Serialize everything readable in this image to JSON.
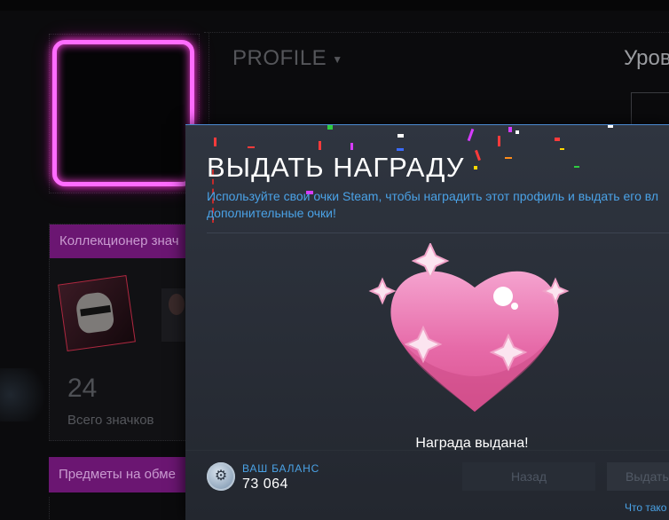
{
  "profile": {
    "dropdown_label": "PROFILE",
    "level_label": "Уров"
  },
  "showcase": {
    "badge_collector_header": "Коллекционер знач",
    "badge_count": "24",
    "badge_count_label": "Всего значков",
    "trade_header": "Предметы на обме"
  },
  "modal": {
    "title": "ВЫДАТЬ НАГРАДУ",
    "description": "Используйте свои очки Steam, чтобы наградить этот профиль и выдать его вл дополнительные очки!",
    "caption": "Награда выдана!",
    "balance_label": "ВАШ БАЛАНС",
    "balance_value": "73 064",
    "back_button": "Назад",
    "give_button": "Выдать",
    "what_link": "Что тако"
  },
  "colors": {
    "accent_blue": "#4aa2e6",
    "neon_pink": "#ff6cff",
    "showcase_header": "#6b1672"
  },
  "icons": {
    "steam_points": "steam-points-icon",
    "heart": "heart-award-icon",
    "sparkle": "sparkle-icon"
  }
}
